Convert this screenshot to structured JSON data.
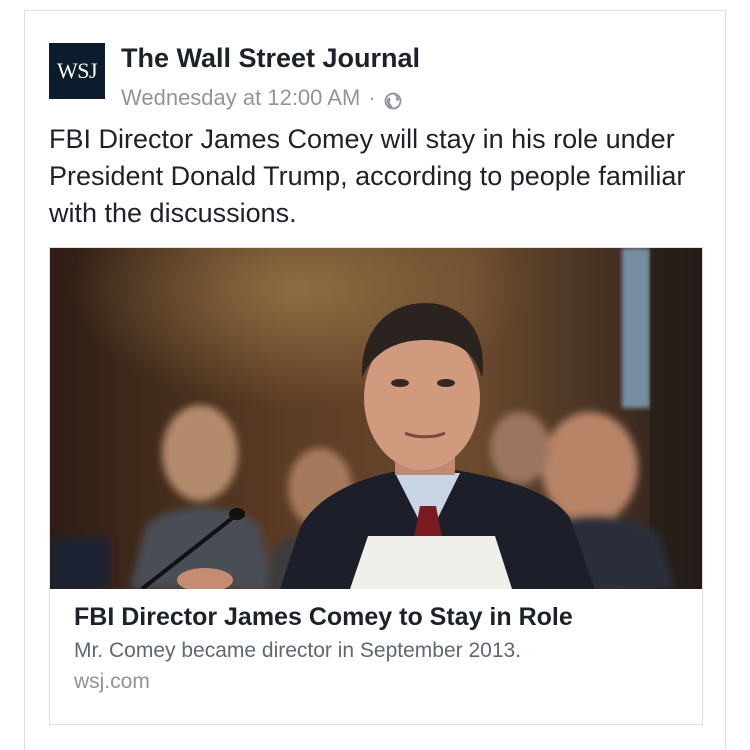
{
  "post": {
    "logo_text": "WSJ",
    "page_name": "The Wall Street Journal",
    "timestamp": "Wednesday at 12:00 AM",
    "separator": "·",
    "privacy_icon": "globe-icon",
    "text": "FBI Director James Comey will stay in his role under President Donald Trump, according to people familiar with the discussions."
  },
  "link": {
    "image_icon": "photo-of-man-at-hearing",
    "title": "FBI Director James Comey to Stay in Role",
    "description": "Mr. Comey became director in September 2013.",
    "domain": "wsj.com"
  },
  "colors": {
    "primary_text": "#1d2129",
    "secondary_text": "#90949c",
    "logo_bg": "#0b1c2c",
    "border": "#dddfe2"
  }
}
